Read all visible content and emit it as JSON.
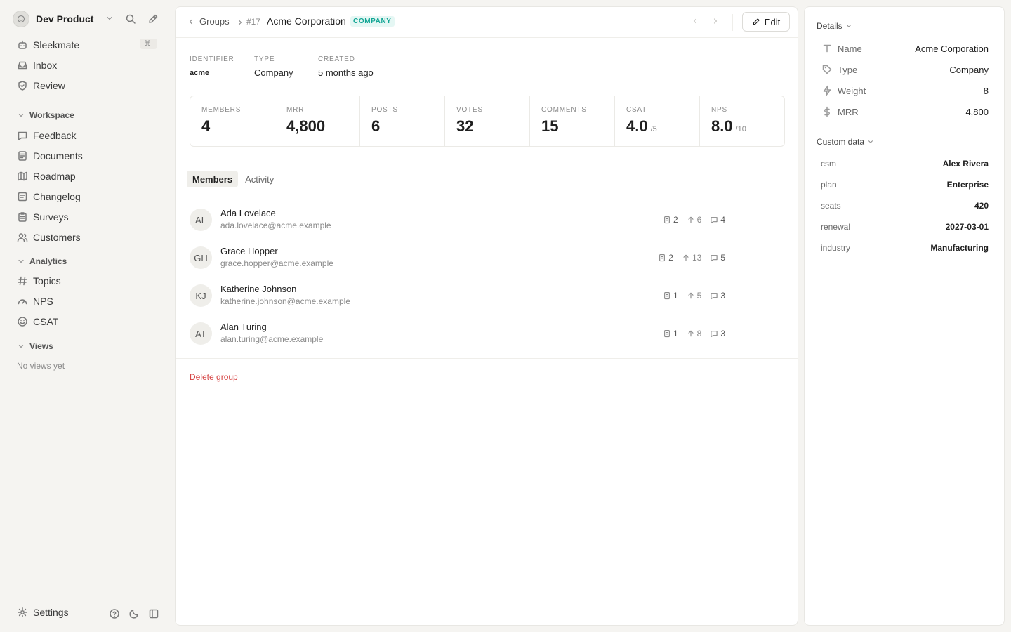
{
  "workspace": {
    "name": "Dev Product"
  },
  "sidebar": {
    "top_items": [
      {
        "label": "Sleekmate",
        "shortcut": "⌘I"
      },
      {
        "label": "Inbox"
      },
      {
        "label": "Review"
      }
    ],
    "workspace_section": {
      "label": "Workspace",
      "items": [
        {
          "label": "Feedback"
        },
        {
          "label": "Documents"
        },
        {
          "label": "Roadmap"
        },
        {
          "label": "Changelog"
        },
        {
          "label": "Surveys"
        },
        {
          "label": "Customers"
        }
      ]
    },
    "analytics_section": {
      "label": "Analytics",
      "items": [
        {
          "label": "Topics"
        },
        {
          "label": "NPS"
        },
        {
          "label": "CSAT"
        }
      ]
    },
    "views_section": {
      "label": "Views",
      "empty_text": "No views yet"
    },
    "footer": {
      "settings_label": "Settings"
    }
  },
  "header": {
    "back_label": "Groups",
    "record_id": "#17",
    "title": "Acme Corporation",
    "badge": "COMPANY",
    "edit_label": "Edit"
  },
  "meta": {
    "identifier_label": "IDENTIFIER",
    "identifier_value": "acme",
    "type_label": "TYPE",
    "type_value": "Company",
    "created_label": "CREATED",
    "created_value": "5 months ago"
  },
  "stats": [
    {
      "label": "MEMBERS",
      "value": "4",
      "suffix": ""
    },
    {
      "label": "MRR",
      "value": "4,800",
      "suffix": ""
    },
    {
      "label": "POSTS",
      "value": "6",
      "suffix": ""
    },
    {
      "label": "VOTES",
      "value": "32",
      "suffix": ""
    },
    {
      "label": "COMMENTS",
      "value": "15",
      "suffix": ""
    },
    {
      "label": "CSAT",
      "value": "4.0",
      "suffix": "/5"
    },
    {
      "label": "NPS",
      "value": "8.0",
      "suffix": "/10"
    }
  ],
  "tabs": [
    {
      "label": "Members",
      "active": true
    },
    {
      "label": "Activity",
      "active": false
    }
  ],
  "members": [
    {
      "initials": "AL",
      "name": "Ada Lovelace",
      "email": "ada.lovelace@acme.example",
      "posts": "2",
      "votes": "6",
      "comments": "4"
    },
    {
      "initials": "GH",
      "name": "Grace Hopper",
      "email": "grace.hopper@acme.example",
      "posts": "2",
      "votes": "13",
      "comments": "5"
    },
    {
      "initials": "KJ",
      "name": "Katherine Johnson",
      "email": "katherine.johnson@acme.example",
      "posts": "1",
      "votes": "5",
      "comments": "3"
    },
    {
      "initials": "AT",
      "name": "Alan Turing",
      "email": "alan.turing@acme.example",
      "posts": "1",
      "votes": "8",
      "comments": "3"
    }
  ],
  "delete_label": "Delete group",
  "details": {
    "section_label": "Details",
    "rows": [
      {
        "icon": "text-icon",
        "key": "Name",
        "value": "Acme Corporation"
      },
      {
        "icon": "tag-icon",
        "key": "Type",
        "value": "Company"
      },
      {
        "icon": "bolt-icon",
        "key": "Weight",
        "value": "8"
      },
      {
        "icon": "dollar-icon",
        "key": "MRR",
        "value": "4,800"
      }
    ]
  },
  "custom_data": {
    "section_label": "Custom data",
    "rows": [
      {
        "key": "csm",
        "value": "Alex Rivera"
      },
      {
        "key": "plan",
        "value": "Enterprise"
      },
      {
        "key": "seats",
        "value": "420"
      },
      {
        "key": "renewal",
        "value": "2027-03-01"
      },
      {
        "key": "industry",
        "value": "Manufacturing"
      }
    ]
  },
  "colors": {
    "accent_badge": "#12a594",
    "danger": "#d64545",
    "background": "#f5f4f1"
  }
}
